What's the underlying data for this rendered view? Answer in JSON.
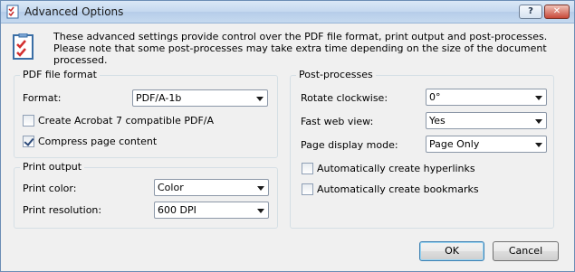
{
  "window": {
    "title": "Advanced Options",
    "help_label": "?",
    "close_label": "✕"
  },
  "info": {
    "text": "These advanced settings provide control over the PDF file format, print output and post-processes. Please note that some post-processes may take extra time depending on the size of the document processed."
  },
  "pdf_format": {
    "title": "PDF file format",
    "format_label": "Format:",
    "format_value": "PDF/A-1b",
    "acrobat7_label": "Create Acrobat 7 compatible PDF/A",
    "acrobat7_checked": false,
    "compress_label": "Compress page content",
    "compress_checked": true
  },
  "print_output": {
    "title": "Print output",
    "color_label": "Print color:",
    "color_value": "Color",
    "resolution_label": "Print resolution:",
    "resolution_value": "600 DPI"
  },
  "post_processes": {
    "title": "Post-processes",
    "rotate_label": "Rotate clockwise:",
    "rotate_value": "0°",
    "fastweb_label": "Fast web view:",
    "fastweb_value": "Yes",
    "display_label": "Page display mode:",
    "display_value": "Page Only",
    "hyperlinks_label": "Automatically create hyperlinks",
    "hyperlinks_checked": false,
    "bookmarks_label": "Automatically create bookmarks",
    "bookmarks_checked": false
  },
  "buttons": {
    "ok": "OK",
    "cancel": "Cancel"
  },
  "colors": {
    "titlebar": "#c4d8ef",
    "dialog_bg": "#f0f0f0",
    "default_button_border": "#3c7fb1"
  }
}
